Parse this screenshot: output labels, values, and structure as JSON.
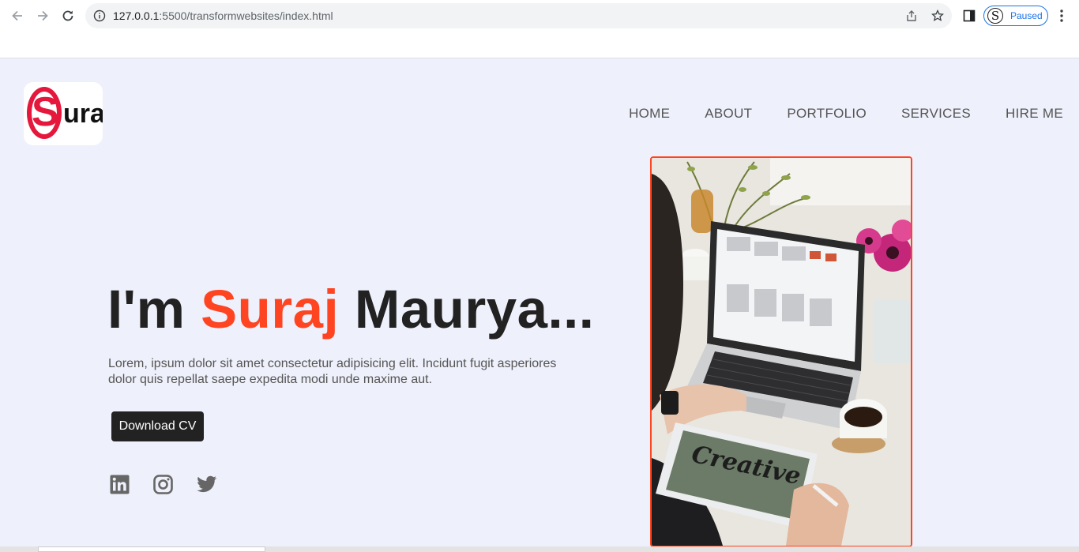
{
  "browser": {
    "url_host": "127.0.0.1",
    "url_rest": ":5500/transformwebsites/index.html",
    "profile_initial": "S",
    "profile_status": "Paused"
  },
  "logo": {
    "first_letter": "S",
    "rest_letters": "uraj"
  },
  "nav": {
    "items": [
      "HOME",
      "ABOUT",
      "PORTFOLIO",
      "SERVICES",
      "HIRE ME"
    ]
  },
  "hero": {
    "title_prefix": "I'm ",
    "title_name": "Suraj",
    "title_suffix": " Maurya...",
    "description": "Lorem, ipsum dolor sit amet consectetur adipisicing elit. Incidunt fugit asperiores dolor quis repellat saepe expedita modi unde maxime aut.",
    "cta_label": "Download CV",
    "image_text": "Creative"
  },
  "social": {
    "icons": [
      "linkedin-icon",
      "instagram-icon",
      "twitter-icon"
    ]
  },
  "colors": {
    "accent": "#ff4422",
    "page_background": "#eef0fb",
    "button_dark": "#222222"
  }
}
